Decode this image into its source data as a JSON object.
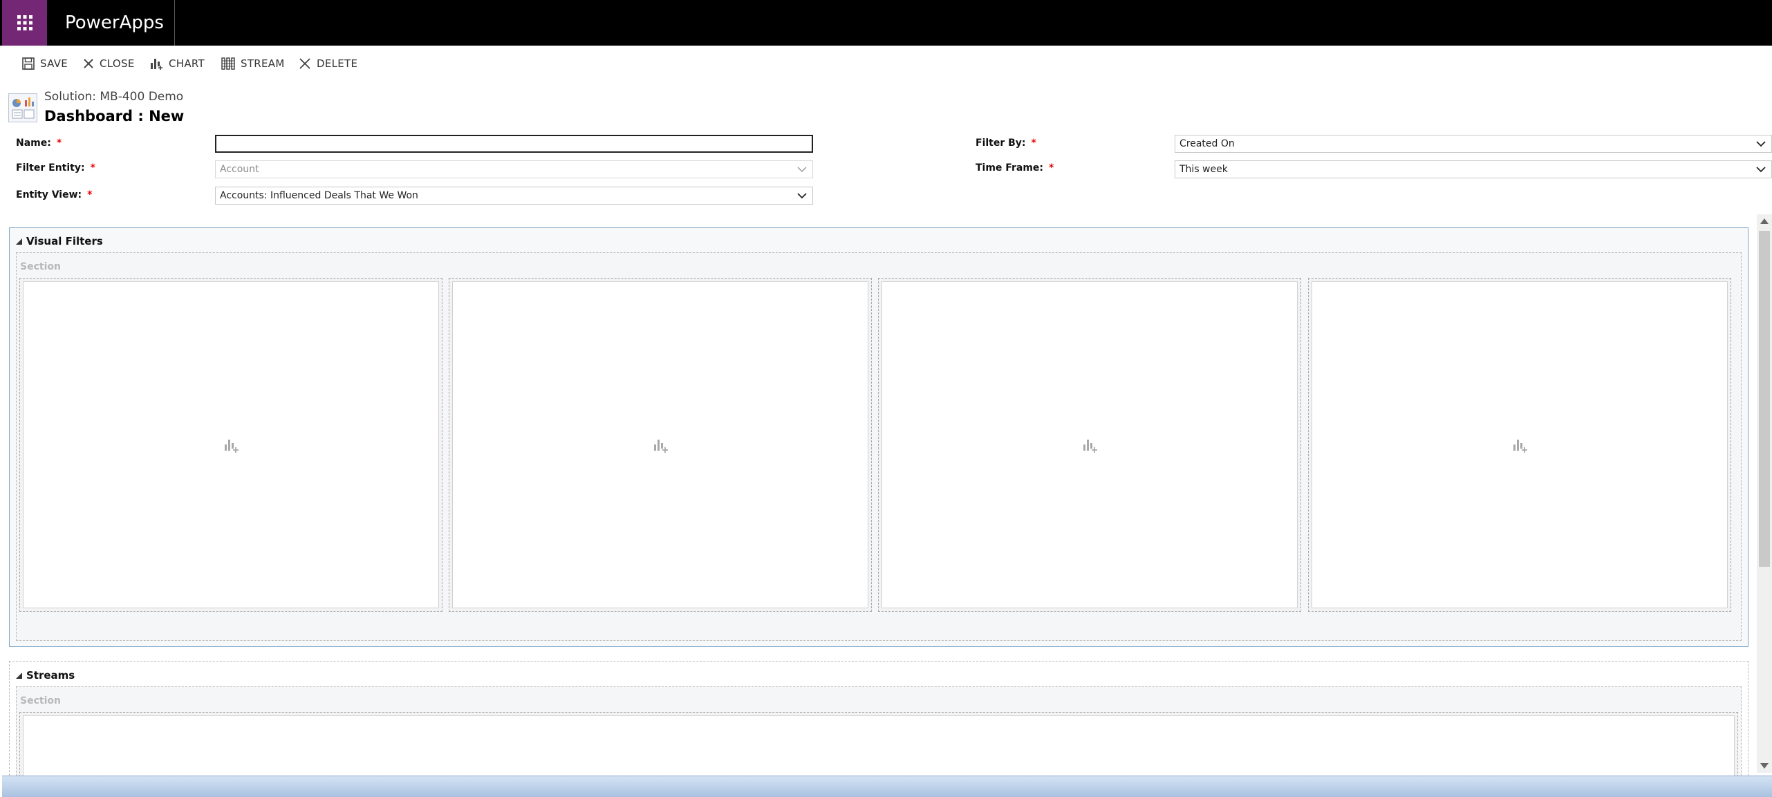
{
  "app": {
    "name": "PowerApps"
  },
  "toolbar": {
    "save": "SAVE",
    "close": "CLOSE",
    "chart": "CHART",
    "stream": "STREAM",
    "delete": "DELETE"
  },
  "header": {
    "solution": "Solution: MB-400 Demo",
    "title": "Dashboard : New"
  },
  "form": {
    "name_label": "Name:",
    "name_value": "",
    "filter_entity_label": "Filter Entity:",
    "filter_entity_value": "Account",
    "entity_view_label": "Entity View:",
    "entity_view_value": "Accounts: Influenced Deals That We Won",
    "filter_by_label": "Filter By:",
    "filter_by_value": "Created On",
    "time_frame_label": "Time Frame:",
    "time_frame_value": "This week",
    "required_marker": "*"
  },
  "visual_filters": {
    "title": "Visual Filters",
    "section_label": "Section",
    "placeholder_icon": "add-chart-icon"
  },
  "streams": {
    "title": "Streams",
    "section_label": "Section"
  },
  "colors": {
    "topbar": "#000000",
    "waffle": "#742774",
    "required": "#e00000"
  }
}
